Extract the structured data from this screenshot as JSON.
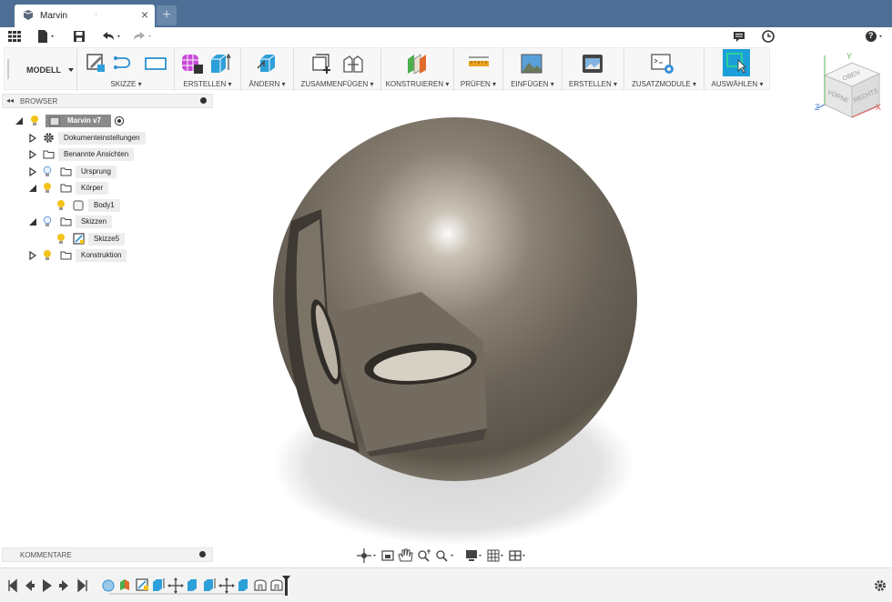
{
  "document": {
    "tab_title": "Marvin",
    "tab_indicator": "·",
    "close_glyph": "×",
    "new_tab_glyph": "+"
  },
  "quick_access": {
    "items": [
      "grid-icon",
      "file-icon",
      "save-icon",
      "undo-icon",
      "redo-icon"
    ],
    "right_items": [
      "comment-icon",
      "clock-icon",
      "help-icon"
    ],
    "help_label": "?"
  },
  "toolbar": {
    "workspace": "MODELL",
    "groups": [
      {
        "label": "SKIZZE",
        "icons": [
          "sketch-create-icon",
          "sketch-arc-icon",
          "rectangle-icon"
        ]
      },
      {
        "label": "ERSTELLEN",
        "icons": [
          "form-grid-icon",
          "box-extrude-icon"
        ]
      },
      {
        "label": "ÄNDERN",
        "icons": [
          "press-pull-icon"
        ]
      },
      {
        "label": "ZUSAMMENFÜGEN",
        "icons": [
          "new-component-icon",
          "joint-icon"
        ]
      },
      {
        "label": "KONSTRUIEREN",
        "icons": [
          "offset-plane-icon"
        ]
      },
      {
        "label": "PRÜFEN",
        "icons": [
          "measure-icon"
        ]
      },
      {
        "label": "EINFÜGEN",
        "icons": [
          "insert-image-icon"
        ]
      },
      {
        "label": "ERSTELLEN",
        "icons": [
          "render-image-icon"
        ]
      },
      {
        "label": "ZUSATZMODULE",
        "icons": [
          "scripts-icon"
        ]
      },
      {
        "label": "AUSWÄHLEN",
        "icons": [
          "select-icon"
        ]
      }
    ]
  },
  "browser": {
    "title": "BROWSER",
    "root": "Marvin v7",
    "items": [
      {
        "label": "Dokumenteinstellungen",
        "icon": "gear-icon",
        "expanded": false
      },
      {
        "label": "Benannte Ansichten",
        "icon": "folder-icon",
        "expanded": false
      },
      {
        "label": "Ursprung",
        "icon": "folder-icon",
        "expanded": false
      },
      {
        "label": "Körper",
        "icon": "folder-icon",
        "expanded": true
      },
      {
        "label": "Body1",
        "icon": "body-icon",
        "expanded": false
      },
      {
        "label": "Skizzen",
        "icon": "folder-icon",
        "expanded": true
      },
      {
        "label": "Skizze5",
        "icon": "sketch-icon",
        "expanded": false
      },
      {
        "label": "Konstruktion",
        "icon": "folder-icon",
        "expanded": false
      }
    ]
  },
  "comments": {
    "title": "KOMMENTARE"
  },
  "viewcube": {
    "faces": [
      "OBEN",
      "VORNE",
      "RECHTS"
    ],
    "axes": [
      "Y",
      "Z",
      "X"
    ],
    "colors": {
      "x": "#e05050",
      "y": "#5ab55a",
      "z": "#4a7fd4"
    }
  },
  "nav_bar": {
    "tools": [
      "orbit-icon",
      "look-at-icon",
      "pan-icon",
      "zoom-icon",
      "fit-icon",
      "display-settings-icon",
      "grid-settings-icon",
      "viewports-icon"
    ]
  },
  "timeline": {
    "controls": [
      "first-icon",
      "prev-icon",
      "play-icon",
      "next-icon",
      "last-icon"
    ],
    "features": [
      "sphere-feature-icon",
      "split-feature-icon",
      "sketch-feature-icon",
      "extrude-feature-icon",
      "move-feature-icon",
      "extrude-feature-icon",
      "extrude-feature-icon",
      "move-feature-icon",
      "extrude-feature-icon",
      "shell-feature-icon",
      "shell-feature-icon"
    ]
  },
  "colors": {
    "tabbar": "#4d6f95",
    "accent": "#1c9fd9",
    "select": "#1aa37a"
  }
}
